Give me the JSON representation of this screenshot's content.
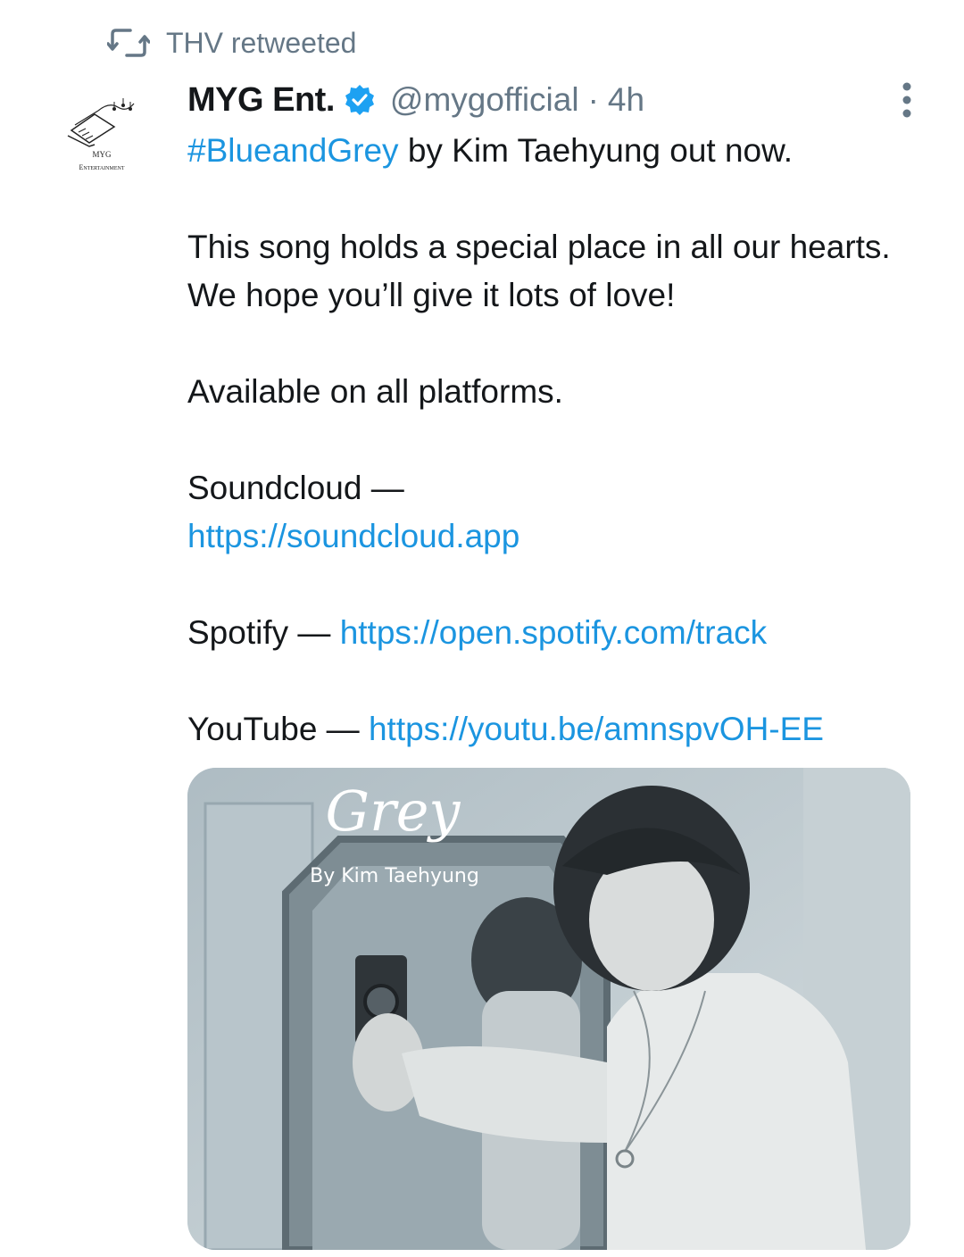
{
  "retweet": {
    "label": "THV retweeted",
    "icon": "retweet-icon"
  },
  "author": {
    "avatar_text_top": "MYG",
    "avatar_text_bottom": "Entertainment",
    "display_name": "MYG Ent.",
    "verified": true,
    "handle": "@mygofficial",
    "separator": "·",
    "time": "4h"
  },
  "tweet": {
    "hashtag": "#BlueandGrey",
    "line1_rest": " by Kim Taehyung out now.",
    "para2": "This song holds a special place in all our hearts. We hope you’ll give it lots of love!",
    "para3": "Available on all platforms.",
    "soundcloud_label": "Soundcloud — ",
    "soundcloud_url": "https://soundcloud.app",
    "spotify_label": "Spotify — ",
    "spotify_url": "https://open.spotify.com/track",
    "youtube_label": "YouTube — ",
    "youtube_url": "https://youtu.be/amnspvOH-EE"
  },
  "media": {
    "title_script": "Grey",
    "subtitle": "By Kim Taehyung"
  },
  "colors": {
    "link": "#1b95e0",
    "muted": "#657786",
    "text": "#14171a",
    "verified": "#1da1f2"
  }
}
